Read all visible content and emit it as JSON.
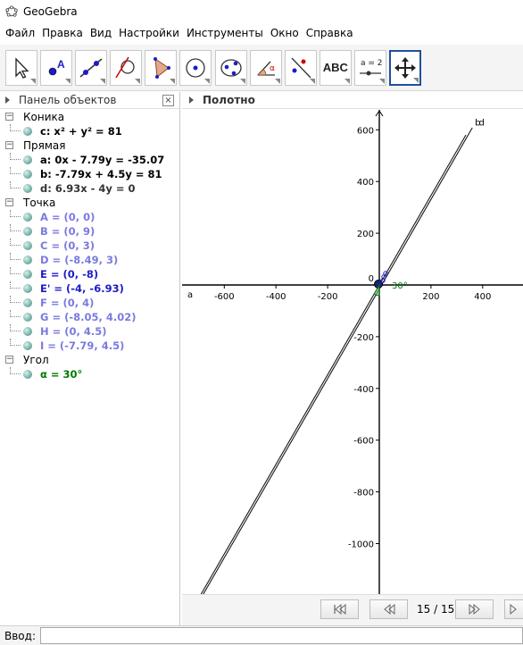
{
  "window": {
    "title": "GeoGebra"
  },
  "menu": [
    "Файл",
    "Правка",
    "Вид",
    "Настройки",
    "Инструменты",
    "Окно",
    "Справка"
  ],
  "toolbar": {
    "text_tool_label": "ABC",
    "slider_tool_label": "a = 2"
  },
  "algebra_panel": {
    "title": "Панель объектов",
    "close_symbol": "×",
    "groups": [
      {
        "label": "Коника",
        "items": [
          {
            "text": "c: x² + y² = 81",
            "color": "black"
          }
        ]
      },
      {
        "label": "Прямая",
        "items": [
          {
            "text": "a: 0x - 7.79y = -35.07",
            "color": "black"
          },
          {
            "text": "b: -7.79x + 4.5y = 81",
            "color": "black"
          },
          {
            "text": "d: 6.93x - 4y = 0",
            "color": "dark"
          }
        ]
      },
      {
        "label": "Точка",
        "items": [
          {
            "text": "A = (0, 0)",
            "color": "light"
          },
          {
            "text": "B = (0, 9)",
            "color": "light"
          },
          {
            "text": "C = (0, 3)",
            "color": "light"
          },
          {
            "text": "D = (-8.49, 3)",
            "color": "light"
          },
          {
            "text": "E = (0, -8)",
            "color": "blue"
          },
          {
            "text": "E' = (-4, -6.93)",
            "color": "blue"
          },
          {
            "text": "F = (0, 4)",
            "color": "light"
          },
          {
            "text": "G = (-8.05, 4.02)",
            "color": "light"
          },
          {
            "text": "H = (0, 4.5)",
            "color": "light"
          },
          {
            "text": "I = (-7.79, 4.5)",
            "color": "light"
          }
        ]
      },
      {
        "label": "Угол",
        "items": [
          {
            "text": "α = 30°",
            "color": "green"
          }
        ]
      }
    ]
  },
  "graphics_panel": {
    "title": "Полотно",
    "x_ticks": [
      "-600",
      "-400",
      "-200",
      "0",
      "200",
      "400"
    ],
    "y_ticks": [
      "600",
      "400",
      "200",
      "0",
      "-200",
      "-400",
      "-600",
      "-800",
      "-1000"
    ],
    "x_axis_label": "a",
    "line_labels": [
      "b",
      "d"
    ],
    "angle_label": "30°"
  },
  "navigation": {
    "counter": "15 / 15",
    "first_icon": "skip-first-icon",
    "prev_icon": "step-back-icon",
    "next_icon": "step-forward-icon",
    "last_icon": "skip-last-icon"
  },
  "input_bar": {
    "label": "Ввод:",
    "value": "",
    "placeholder": ""
  },
  "colors": {
    "active_tool_border": "#1f4fa0",
    "line": "#1a1a1a",
    "angle": "#007a00",
    "point": "#1c1cc8"
  }
}
